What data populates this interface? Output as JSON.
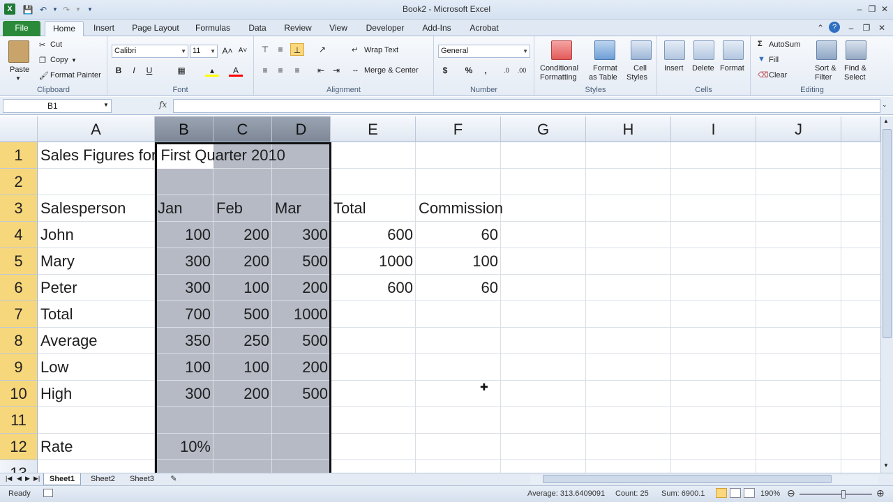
{
  "window": {
    "title": "Book2 - Microsoft Excel"
  },
  "tabs": [
    "File",
    "Home",
    "Insert",
    "Page Layout",
    "Formulas",
    "Data",
    "Review",
    "View",
    "Developer",
    "Add-Ins",
    "Acrobat"
  ],
  "ribbon": {
    "clipboard": {
      "label": "Clipboard",
      "paste": "Paste",
      "cut": "Cut",
      "copy": "Copy",
      "format_painter": "Format Painter"
    },
    "font": {
      "label": "Font",
      "name": "Calibri",
      "size": "11"
    },
    "alignment": {
      "label": "Alignment",
      "wrap_text": "Wrap Text",
      "merge_center": "Merge & Center"
    },
    "number": {
      "label": "Number",
      "format": "General"
    },
    "styles": {
      "label": "Styles",
      "conditional_line1": "Conditional",
      "conditional_line2": "Formatting",
      "format_table_line1": "Format",
      "format_table_line2": "as Table",
      "cell_styles_line1": "Cell",
      "cell_styles_line2": "Styles"
    },
    "cells": {
      "label": "Cells",
      "insert": "Insert",
      "delete": "Delete",
      "format": "Format"
    },
    "editing": {
      "label": "Editing",
      "autosum": "AutoSum",
      "fill": "Fill",
      "clear": "Clear",
      "sort_line1": "Sort &",
      "sort_line2": "Filter",
      "find_line1": "Find &",
      "find_line2": "Select"
    }
  },
  "formula_bar": {
    "name_box": "B1",
    "fx": "fx",
    "value": ""
  },
  "columns": [
    "A",
    "B",
    "C",
    "D",
    "E",
    "F",
    "G",
    "H",
    "I",
    "J"
  ],
  "rows": [
    "1",
    "2",
    "3",
    "4",
    "5",
    "6",
    "7",
    "8",
    "9",
    "10",
    "11",
    "12",
    "13"
  ],
  "cells": {
    "A1": "Sales Figures for First Quarter 2010",
    "A3": "Salesperson",
    "B3": "Jan",
    "C3": "Feb",
    "D3": "Mar",
    "E3": "Total",
    "F3": "Commission",
    "A4": "John",
    "B4": "100",
    "C4": "200",
    "D4": "300",
    "E4": "600",
    "F4": "60",
    "A5": "Mary",
    "B5": "300",
    "C5": "200",
    "D5": "500",
    "E5": "1000",
    "F5": "100",
    "A6": "Peter",
    "B6": "300",
    "C6": "100",
    "D6": "200",
    "E6": "600",
    "F6": "60",
    "A7": "Total",
    "B7": "700",
    "C7": "500",
    "D7": "1000",
    "A8": "Average",
    "B8": "350",
    "C8": "250",
    "D8": "500",
    "A9": "Low",
    "B9": "100",
    "C9": "100",
    "D9": "200",
    "A10": "High",
    "B10": "300",
    "C10": "200",
    "D10": "500",
    "A12": "Rate",
    "B12": "10%"
  },
  "sheets": [
    "Sheet1",
    "Sheet2",
    "Sheet3"
  ],
  "status": {
    "mode": "Ready",
    "average": "Average: 313.6409091",
    "count": "Count: 25",
    "sum": "Sum: 6900.1",
    "zoom": "190%"
  }
}
